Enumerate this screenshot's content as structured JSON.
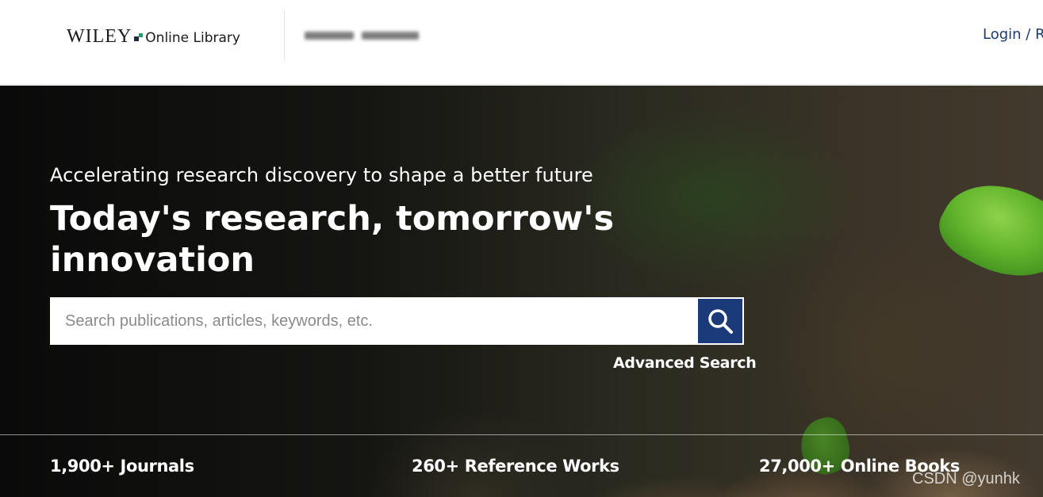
{
  "header": {
    "logo_wordmark": "WILEY",
    "logo_subtitle": "Online Library",
    "login_link": "Login / Register"
  },
  "hero": {
    "tagline": "Accelerating research discovery to shape a better future",
    "title": "Today's research, tomorrow's innovation",
    "search": {
      "placeholder": "Search publications, articles, keywords, etc.",
      "value": "",
      "button_icon": "search-icon"
    },
    "advanced_search": "Advanced Search",
    "stats": [
      {
        "label": "1,900+ Journals"
      },
      {
        "label": "260+ Reference Works"
      },
      {
        "label": "27,000+ Online Books"
      }
    ]
  },
  "watermark": "CSDN @yunhk",
  "colors": {
    "brand_navy": "#1a3a7a",
    "brand_green": "#18a06a",
    "link_blue": "#1e3a6e"
  }
}
